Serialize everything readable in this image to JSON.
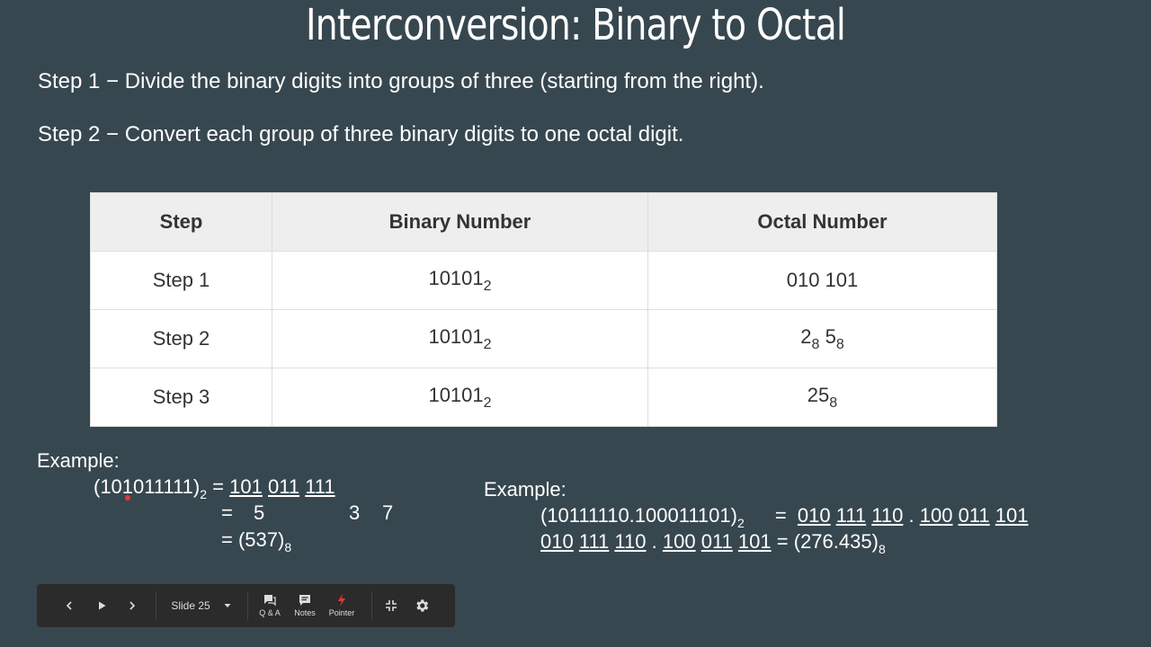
{
  "title": "Interconversion: Binary to Octal",
  "steps": {
    "step1": "Step 1 − Divide the binary digits into groups of three (starting from the right).",
    "step2": "Step 2 − Convert each group of three binary digits to one octal digit."
  },
  "table": {
    "headers": [
      "Step",
      "Binary Number",
      "Octal Number"
    ],
    "rows": [
      {
        "step": "Step 1",
        "binary": "10101",
        "binary_base": "2",
        "octal": "010 101"
      },
      {
        "step": "Step 2",
        "binary": "10101",
        "binary_base": "2",
        "octal_a": "2",
        "octal_b": "5",
        "octal_base": "8"
      },
      {
        "step": "Step 3",
        "binary": "10101",
        "binary_base": "2",
        "octal": "25",
        "octal_base": "8"
      }
    ]
  },
  "example1": {
    "label": "Example:",
    "number": "(101011111)",
    "base_in": "2",
    "eq": "=",
    "groups": [
      "101",
      "011",
      "111"
    ],
    "digits": [
      "5",
      "3",
      "7"
    ],
    "result": "(537)",
    "base_out": "8"
  },
  "example2": {
    "label": "Example:",
    "number": "(10111110.100011101)",
    "base_in": "2",
    "eq": "=",
    "groups": [
      "010",
      "111",
      "110",
      ".",
      "100",
      "011",
      "101"
    ],
    "result": "(276.435)",
    "base_out": "8"
  },
  "controls": {
    "slide_label": "Slide 25",
    "qa_label": "Q & A",
    "notes_label": "Notes",
    "pointer_label": "Pointer",
    "pointer_color": "#e53935"
  }
}
